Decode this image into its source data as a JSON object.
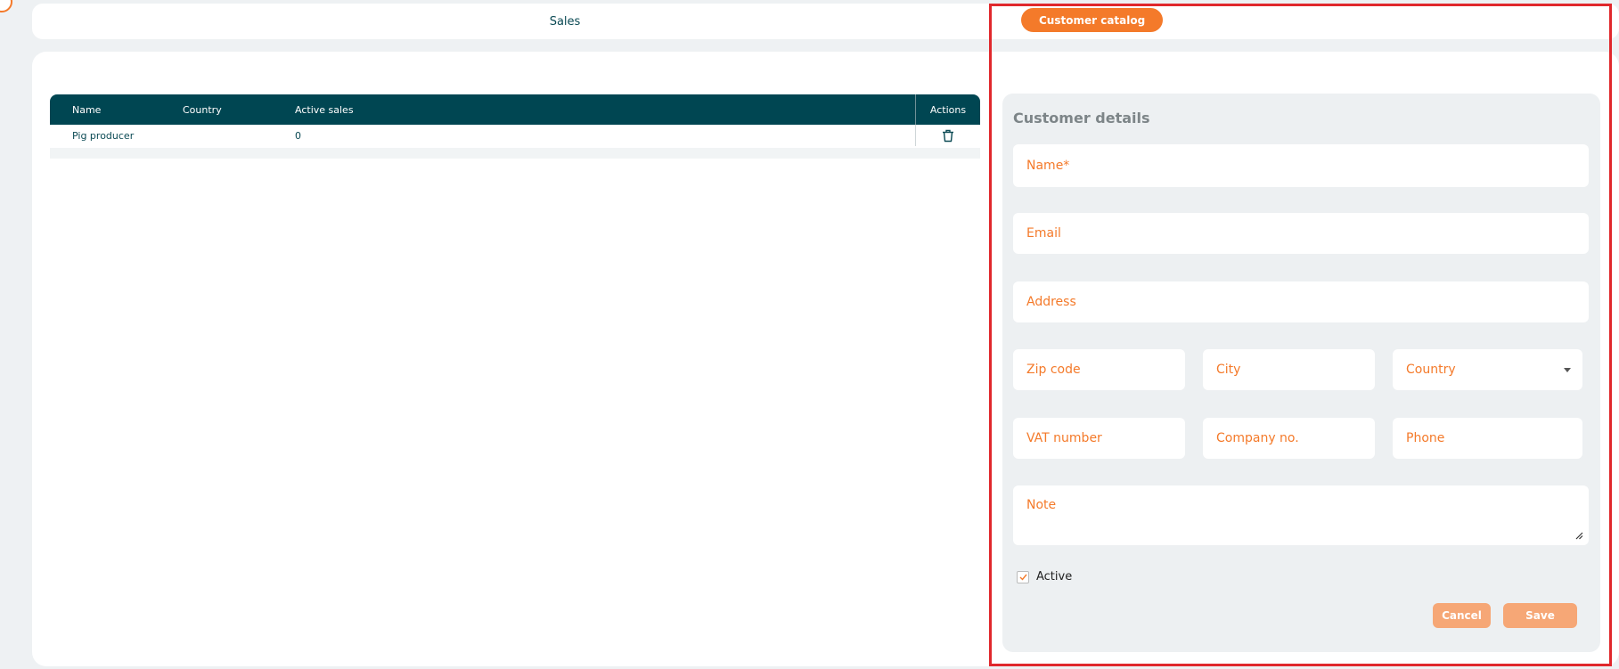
{
  "topnav": {
    "tabs": [
      {
        "label": "Sales"
      },
      {
        "label": "Customer catalog"
      }
    ]
  },
  "table": {
    "columns": [
      "Name",
      "Country",
      "Active sales",
      "Actions"
    ],
    "rows": [
      {
        "name": "Pig producer",
        "country": "",
        "active_sales": "0"
      }
    ]
  },
  "details": {
    "title": "Customer details",
    "name_placeholder": "Name*",
    "email_placeholder": "Email",
    "address_placeholder": "Address",
    "zip_placeholder": "Zip code",
    "city_placeholder": "City",
    "country_placeholder": "Country",
    "vat_placeholder": "VAT number",
    "company_placeholder": "Company no.",
    "phone_placeholder": "Phone",
    "note_placeholder": "Note",
    "active_label": "Active",
    "active_checked": true,
    "cancel_label": "Cancel",
    "save_label": "Save"
  },
  "colors": {
    "accent": "#f47a2a",
    "header": "#004652",
    "highlight": "#e0282c"
  }
}
